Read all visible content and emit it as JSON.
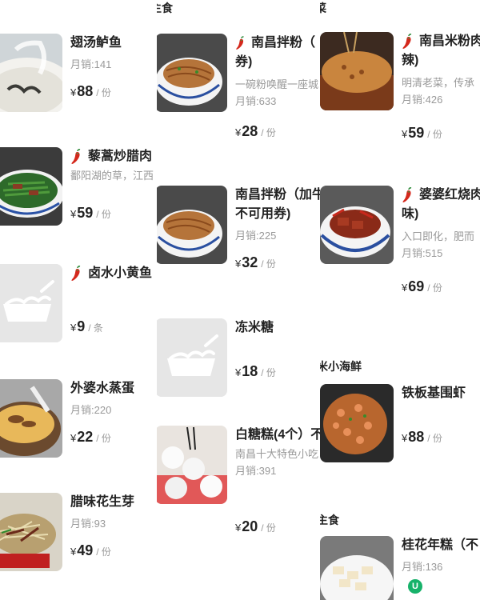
{
  "col1": {
    "items": [
      {
        "name": "翅汤鲈鱼",
        "sales": "月销:141",
        "currency": "¥",
        "price": "88",
        "unit": "/ 份",
        "spicy": false
      },
      {
        "name": "藜蒿炒腊肉",
        "desc": "鄱阳湖的草，江西",
        "currency": "¥",
        "price": "59",
        "unit": "/ 份",
        "spicy": true
      },
      {
        "name": "卤水小黄鱼",
        "currency": "¥",
        "price": "9",
        "unit": "/ 条",
        "spicy": true
      },
      {
        "name": "外婆水蒸蛋",
        "sales": "月销:220",
        "currency": "¥",
        "price": "22",
        "unit": "/ 份",
        "spicy": false
      },
      {
        "name": "腊味花生芽",
        "sales": "月销:93",
        "currency": "¥",
        "price": "49",
        "unit": "/ 份",
        "spicy": false
      }
    ]
  },
  "col2": {
    "header": "主食",
    "items": [
      {
        "name_line1": "南昌拌粉（",
        "name_line2": "券)",
        "desc": "一碗粉唤醒一座城",
        "sales": "月销:633",
        "currency": "¥",
        "price": "28",
        "unit": "/ 份",
        "spicy": true
      },
      {
        "name_line1": "南昌拌粉（加牛",
        "name_line2": "不可用券)",
        "sales": "月销:225",
        "currency": "¥",
        "price": "32",
        "unit": "/ 份",
        "spicy": false
      },
      {
        "name": "冻米糖",
        "currency": "¥",
        "price": "18",
        "unit": "/ 份",
        "spicy": false
      },
      {
        "name": "白糖糕(4个）不",
        "desc": "南昌十大特色小吃",
        "sales": "月销:391",
        "currency": "¥",
        "price": "20",
        "unit": "/ 份",
        "spicy": false
      }
    ]
  },
  "col3": {
    "header_top": "菜",
    "header_seafood": "米小海鲜",
    "header_staple": "主食",
    "items": [
      {
        "name_line1": "南昌米粉肉",
        "name_line2": "辣)",
        "desc": "明清老菜，传承",
        "sales": "月销:426",
        "currency": "¥",
        "price": "59",
        "unit": "/ 份",
        "spicy": true
      },
      {
        "name_line1": "婆婆红烧肉",
        "name_line2": "味)",
        "desc": "入口即化，肥而",
        "sales": "月销:515",
        "currency": "¥",
        "price": "69",
        "unit": "/ 份",
        "spicy": true
      },
      {
        "name": "铁板基围虾",
        "currency": "¥",
        "price": "88",
        "unit": "/ 份",
        "spicy": false
      },
      {
        "name": "桂花年糕（不",
        "sales": "月销:136",
        "spicy": false
      }
    ],
    "badge": "U"
  },
  "colors": {
    "chili": "#d4281c",
    "placeholder": "#e6e6e6",
    "badge": "#17b26a"
  }
}
